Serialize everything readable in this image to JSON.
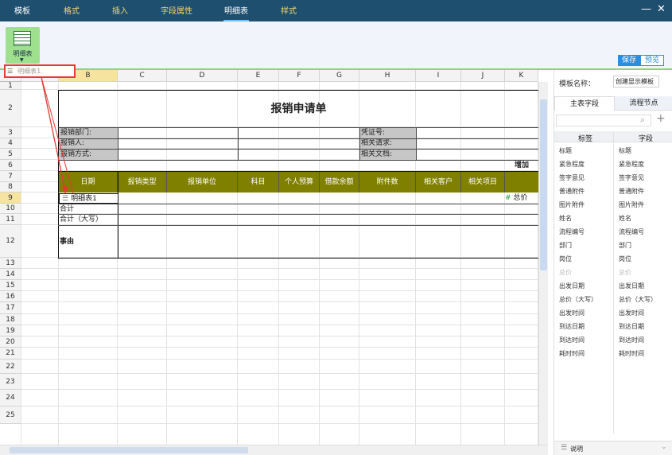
{
  "menu": {
    "tabs": [
      {
        "label": "模板"
      },
      {
        "label": "格式"
      },
      {
        "label": "插入"
      },
      {
        "label": "字段属性"
      },
      {
        "label": "明细表"
      },
      {
        "label": "样式"
      }
    ]
  },
  "window": {
    "minimize": "—",
    "close": "✕"
  },
  "toolbar": {
    "detail_table_label": "明细表",
    "save_label": "保存",
    "preview_label": "预览"
  },
  "sheet_tag": {
    "label": "明细表1"
  },
  "columns": [
    "B",
    "C",
    "D",
    "E",
    "F",
    "G",
    "H",
    "I",
    "J",
    "K"
  ],
  "rows": [
    "1",
    "2",
    "3",
    "4",
    "5",
    "6",
    "7",
    "8",
    "9",
    "10",
    "11",
    "12",
    "13",
    "14",
    "15",
    "16",
    "17",
    "18",
    "19",
    "20",
    "21",
    "22",
    "23",
    "24",
    "25"
  ],
  "form": {
    "title": "报销申请单",
    "dept_label": "报销部门:",
    "person_label": "报销人:",
    "method_label": "报销方式:",
    "voucher_label": "凭证号:",
    "request_label": "相关请求:",
    "doc_label": "相关文档:",
    "add_label": "增加",
    "headers": [
      "日期",
      "报销类型",
      "报销单位",
      "科目",
      "个人预算",
      "借款余额",
      "附件数",
      "相关客户",
      "相关项目"
    ],
    "detail_label": "明细表1",
    "total_label": "合计",
    "total_upper_label": "合计（大写）",
    "reason_label": "事由",
    "total_price_label": "总价"
  },
  "panel": {
    "template_name_label": "模板名称：",
    "template_name_value": "创建显示模板",
    "tab_main": "主表字段",
    "tab_flow": "流程节点",
    "col_tag": "标签",
    "col_field": "字段",
    "tags": [
      "标题",
      "紧急程度",
      "签字意见",
      "普通附件",
      "图片附件",
      "姓名",
      "流程编号",
      "部门",
      "岗位",
      "总价",
      "出发日期",
      "总价（大写）",
      "出发时间",
      "到达日期",
      "到达时间",
      "耗时时间"
    ],
    "fields": [
      "标题",
      "紧急程度",
      "签字意见",
      "普通附件",
      "图片附件",
      "姓名",
      "流程编号",
      "部门",
      "岗位",
      "总价",
      "出发日期",
      "总价（大写）",
      "出发时间",
      "到达日期",
      "到达时间",
      "耗时时间"
    ],
    "footer": "说明"
  },
  "colors": {
    "menubar": "#1f4f6f",
    "header_fill": "#7f7f00",
    "accent_green": "#9ee08d",
    "save_blue": "#2b8ee0",
    "highlight_red": "#e53935"
  }
}
